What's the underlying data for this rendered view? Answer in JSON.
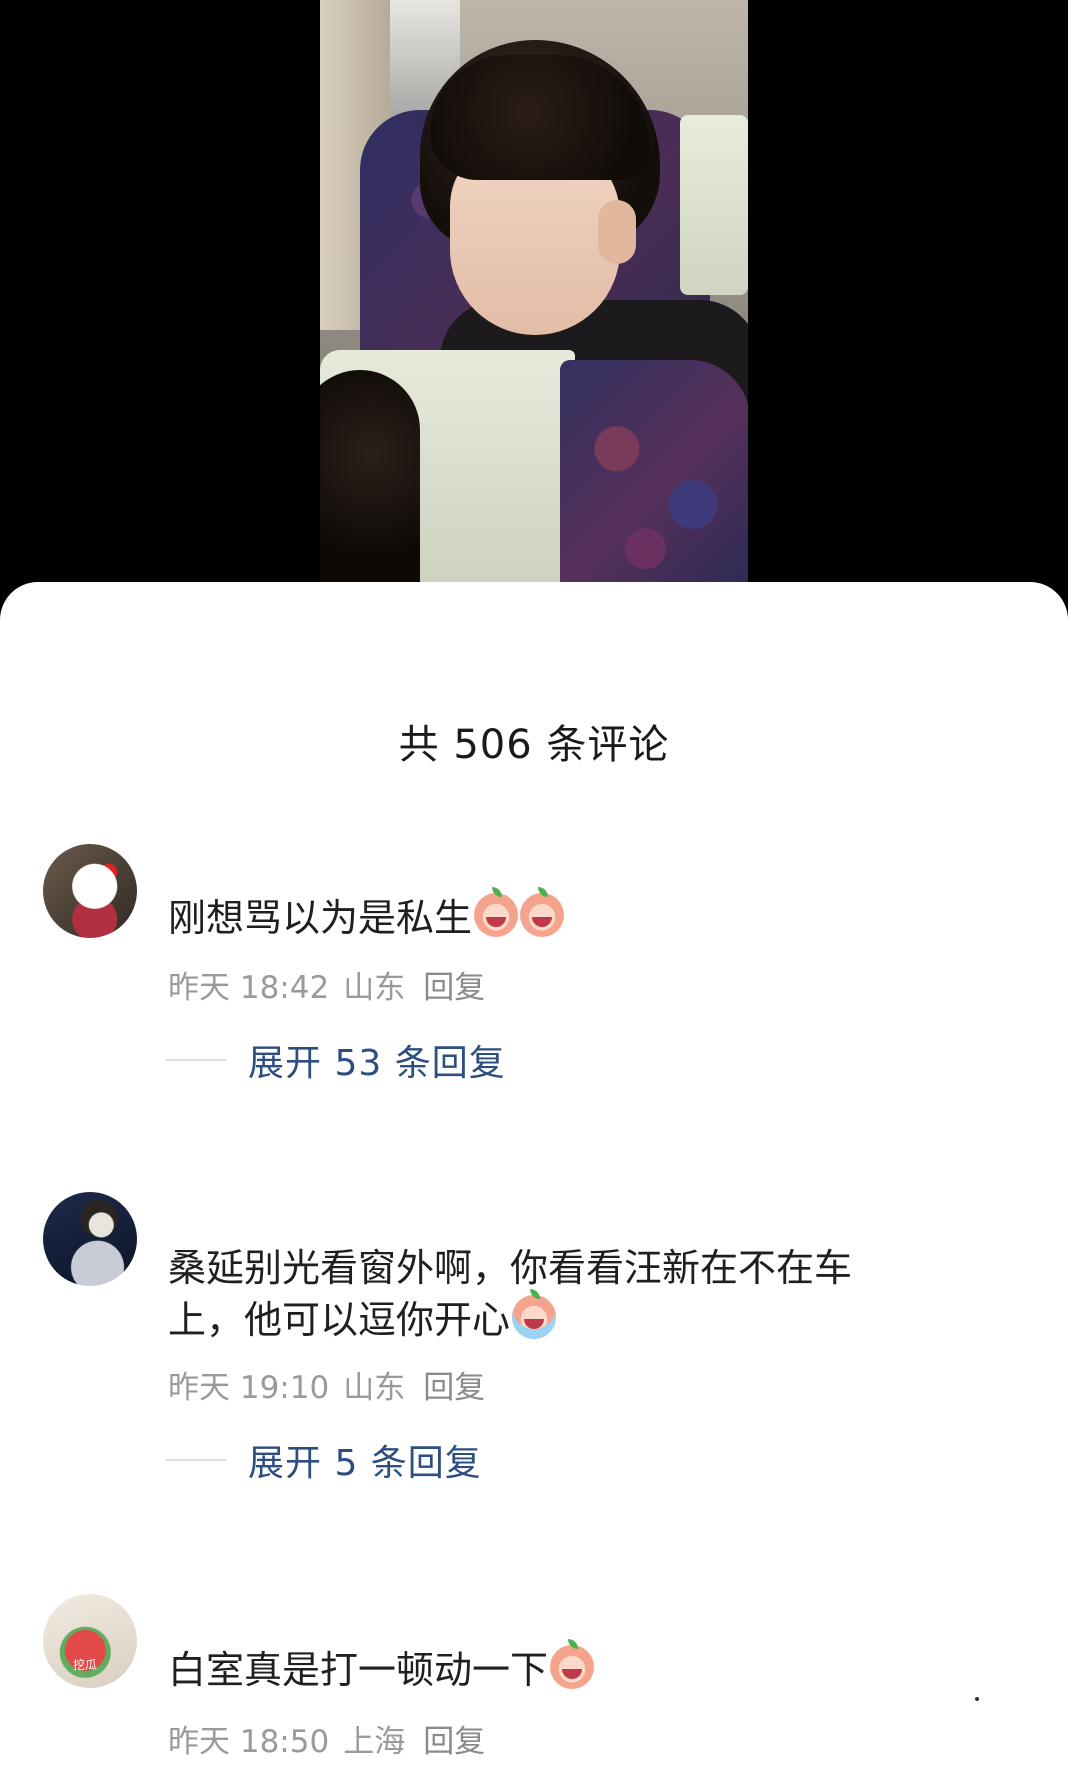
{
  "comments_header": {
    "title": "共 506 条评论"
  },
  "comments": [
    {
      "text": "刚想骂以为是私生",
      "emojis": [
        "crying-peach-emoji",
        "crying-peach-emoji"
      ],
      "time": "昨天 18:42",
      "location": "山东",
      "reply_label": "回复",
      "expand_label": "展开 53 条回复"
    },
    {
      "text_line1": "桑延别光看窗外啊，你看看汪新在不在车",
      "text_line2": "上，他可以逗你开心",
      "emojis": [
        "tearful-peach-emoji"
      ],
      "time": "昨天 19:10",
      "location": "山东",
      "reply_label": "回复",
      "expand_label": "展开 5 条回复"
    },
    {
      "text": "白室真是打一顿动一下",
      "emojis": [
        "angry-peach-emoji"
      ],
      "time": "昨天 18:50",
      "location": "上海",
      "reply_label": "回复",
      "avatar_mark": "挖瓜"
    }
  ],
  "colors": {
    "accent_link": "#2d4f80",
    "meta_gray": "#9a9a9a",
    "sheet_bg": "#ffffff",
    "video_bg": "#000000"
  }
}
